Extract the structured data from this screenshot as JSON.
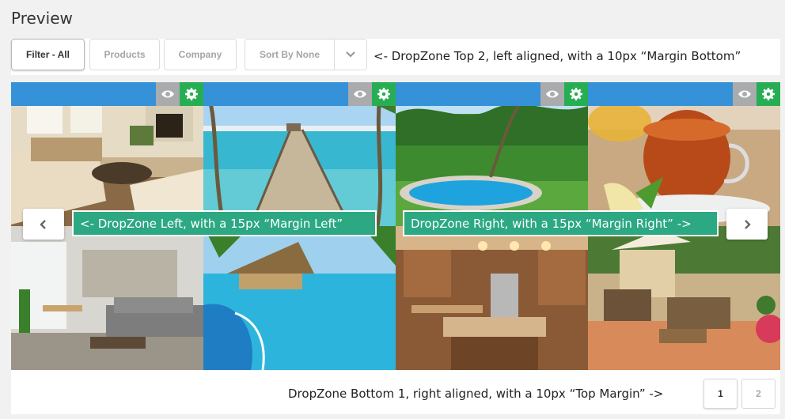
{
  "page": {
    "heading": "Preview"
  },
  "toolbar": {
    "filters": [
      {
        "label": "Filter - All",
        "active": true
      },
      {
        "label": "Products",
        "active": false
      },
      {
        "label": "Company",
        "active": false
      }
    ],
    "sort_label": "Sort By None",
    "sort_caret_icon": "chevron-down-icon",
    "note": "<- DropZone Top 2, left aligned, with a 10px “Margin Bottom”"
  },
  "gallery": {
    "tiles": [
      {
        "subject": "living-room"
      },
      {
        "subject": "beach-pier"
      },
      {
        "subject": "tropical-pool"
      },
      {
        "subject": "tea-cup"
      },
      {
        "subject": "modern-interior"
      },
      {
        "subject": "resort-pool"
      },
      {
        "subject": "kitchen"
      },
      {
        "subject": "patio"
      }
    ],
    "controls": {
      "view_icon": "eye-icon",
      "settings_icon": "gear-icon"
    },
    "prev_icon": "chevron-left-icon",
    "next_icon": "chevron-right-icon",
    "dropzone_left": "<- DropZone Left, with a 15px “Margin Left”",
    "dropzone_right": "DropZone Right, with a 15px “Margin Right” ->"
  },
  "footer": {
    "note": "DropZone Bottom 1, right aligned, with a 10px “Top Margin” ->",
    "pages": [
      "1",
      "2"
    ]
  },
  "colors": {
    "bar": "#3591d8",
    "dropzone": "#2ca883",
    "gear_bg": "#27ae53",
    "eye_bg": "#a9abad"
  }
}
